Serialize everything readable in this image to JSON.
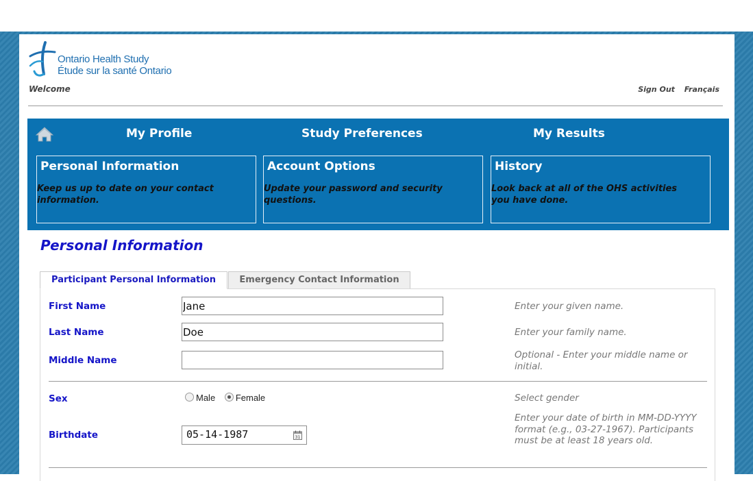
{
  "header": {
    "logo_line1": "Ontario Health Study",
    "logo_line2": "Étude sur la santé Ontario",
    "welcome": "Welcome",
    "sign_out": "Sign Out",
    "language": "Français"
  },
  "nav": {
    "home_icon": "home-icon",
    "tabs": [
      {
        "label": "My Profile"
      },
      {
        "label": "Study Preferences"
      },
      {
        "label": "My Results"
      }
    ],
    "cards": [
      {
        "title": "Personal Information",
        "desc": "Keep us up to date on your contact information."
      },
      {
        "title": "Account Options",
        "desc": "Update your password and security questions."
      },
      {
        "title": "History",
        "desc": "Look back at all of the OHS activities you have done."
      }
    ]
  },
  "page": {
    "title": "Personal Information",
    "tabs": [
      {
        "label": "Participant Personal Information",
        "active": true
      },
      {
        "label": "Emergency Contact Information",
        "active": false
      }
    ]
  },
  "form": {
    "first_name": {
      "label": "First Name",
      "value": "Jane",
      "hint": "Enter your given name."
    },
    "last_name": {
      "label": "Last Name",
      "value": "Doe",
      "hint": "Enter your family name."
    },
    "middle_name": {
      "label": "Middle Name",
      "value": "",
      "hint": "Optional - Enter your middle name or initial."
    },
    "sex": {
      "label": "Sex",
      "options": [
        "Male",
        "Female"
      ],
      "selected": "Female",
      "hint": "Select gender"
    },
    "birthdate": {
      "label": "Birthdate",
      "value": "05-14-1987",
      "hint": "Enter your date of birth in MM-DD-YYYY format (e.g., 03-27-1967). Participants must be at least 18 years old.",
      "icon": "calendar-icon"
    }
  },
  "colors": {
    "nav_bg": "#0b72b2",
    "label": "#1515c8",
    "page_bg": "#2d7faf"
  }
}
